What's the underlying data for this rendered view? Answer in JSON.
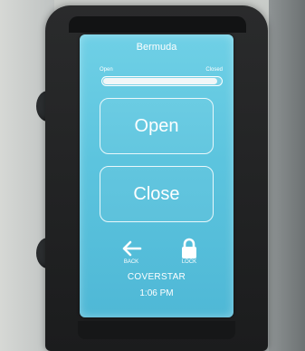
{
  "header": {
    "title": "Bermuda"
  },
  "position": {
    "open_label": "Open",
    "closed_label": "Closed",
    "fraction_closed": 0.97
  },
  "buttons": {
    "open_label": "Open",
    "close_label": "Close"
  },
  "footer": {
    "back_label": "BACK",
    "lock_label": "LOCK",
    "brand": "COVERSTAR",
    "time": "1:06 PM"
  },
  "colors": {
    "screen": "#5cc4de",
    "text": "#ffffff"
  }
}
